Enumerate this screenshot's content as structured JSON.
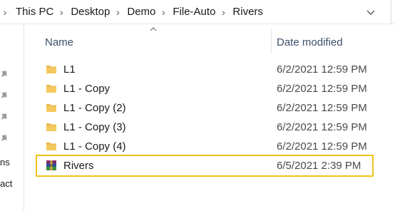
{
  "breadcrumb": {
    "items": [
      "This PC",
      "Desktop",
      "Demo",
      "File-Auto",
      "Rivers"
    ]
  },
  "columns": {
    "name": "Name",
    "date_modified": "Date modified"
  },
  "nav_partial": {
    "item_1": "ns",
    "item_2": "act"
  },
  "files": [
    {
      "name": "L1",
      "date": "6/2/2021 12:59 PM",
      "icon": "folder-icon"
    },
    {
      "name": "L1 - Copy",
      "date": "6/2/2021 12:59 PM",
      "icon": "folder-icon"
    },
    {
      "name": "L1 - Copy (2)",
      "date": "6/2/2021 12:59 PM",
      "icon": "folder-icon"
    },
    {
      "name": "L1 - Copy (3)",
      "date": "6/2/2021 12:59 PM",
      "icon": "folder-icon"
    },
    {
      "name": "L1 - Copy (4)",
      "date": "6/2/2021 12:59 PM",
      "icon": "folder-icon"
    },
    {
      "name": "Rivers",
      "date": "6/5/2021 2:39 PM",
      "icon": "winrar-archive-icon"
    }
  ],
  "colors": {
    "folder": "#e8b64a",
    "highlight": "#f0c419",
    "header_text": "#3c4e6b"
  }
}
